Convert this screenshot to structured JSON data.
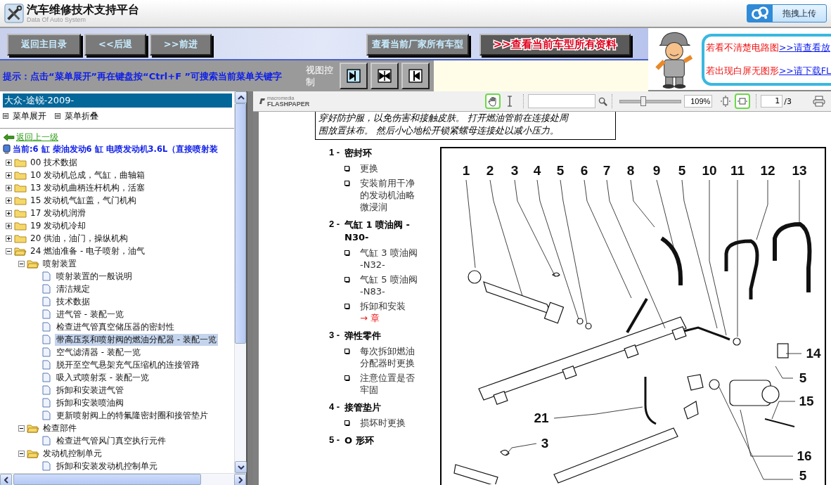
{
  "header": {
    "title": "汽车维修技术支持平台",
    "subtitle": "Data Of Auto System",
    "upload_button": "拖拽上传"
  },
  "nav_buttons": [
    "返回主目录",
    "<<后退",
    ">>前进"
  ],
  "model_buttons": [
    {
      "label": "查看当前厂家所有车型",
      "kind": "plain"
    },
    {
      "label": ">>查看当前车型所有资料",
      "kind": "highlight"
    }
  ],
  "hint": {
    "text": "提示：点击“菜单展开”再在键盘按“Ctrl+F ”可搜索当前菜单关键字",
    "view_label": "视图控制",
    "view_buttons": [
      {
        "kind": "right",
        "selected": true
      },
      {
        "kind": "split",
        "selected": false
      },
      {
        "kind": "left",
        "selected": false
      }
    ]
  },
  "notice": {
    "lines": [
      {
        "text": "若看不清楚电路图",
        "link": ">>请查看放"
      },
      {
        "text": "若出现白屏无图形",
        "link": ">>请下载FL"
      }
    ]
  },
  "sidebar": {
    "vehicle": "大众-途锐-2009-",
    "menu": [
      "菜单展开",
      "菜单折叠"
    ],
    "back_link": "返回上一级",
    "current": "当前:6 缸  柴油发动6 缸  电喷发动机3.6L（直接喷射装",
    "tree": [
      {
        "label": "00 技术数据",
        "kind": "folder",
        "expanded": false,
        "selected": false
      },
      {
        "label": "10 发动机总成，气缸，曲轴箱",
        "kind": "folder",
        "expanded": false,
        "selected": false
      },
      {
        "label": "13 发动机曲柄连杆机构，活塞",
        "kind": "folder",
        "expanded": false,
        "selected": false
      },
      {
        "label": "15 发动机气缸盖，气门机构",
        "kind": "folder",
        "expanded": false,
        "selected": false
      },
      {
        "label": "17 发动机润滑",
        "kind": "folder",
        "expanded": false,
        "selected": false
      },
      {
        "label": "19 发动机冷却",
        "kind": "folder",
        "expanded": false,
        "selected": false
      },
      {
        "label": "20 供油，油门，操纵机构",
        "kind": "folder",
        "expanded": false,
        "selected": false
      },
      {
        "label": "24 燃油准备 - 电子喷射，油气",
        "kind": "folder",
        "expanded": true,
        "selected": false,
        "children": [
          {
            "label": "喷射装置",
            "kind": "folder",
            "expanded": true,
            "selected": false,
            "children": [
              {
                "label": "喷射装置的一般说明",
                "kind": "doc",
                "selected": false
              },
              {
                "label": "清洁规定",
                "kind": "doc",
                "selected": false
              },
              {
                "label": "技术数据",
                "kind": "doc",
                "selected": false
              },
              {
                "label": "进气管 - 装配一览",
                "kind": "doc",
                "selected": false
              },
              {
                "label": "检查进气管真空储压器的密封性",
                "kind": "doc",
                "selected": false
              },
              {
                "label": "带高压泵和喷射阀的燃油分配器 - 装配一览",
                "kind": "doc",
                "selected": true
              },
              {
                "label": "空气滤清器 - 装配一览",
                "kind": "doc",
                "selected": false
              },
              {
                "label": "脱开至空气悬架充气压缩机的连接管路",
                "kind": "doc",
                "selected": false
              },
              {
                "label": "吸入式喷射泵 - 装配一览",
                "kind": "doc",
                "selected": false
              },
              {
                "label": "拆卸和安装进气管",
                "kind": "doc",
                "selected": false
              },
              {
                "label": "拆卸和安装喷油阀",
                "kind": "doc",
                "selected": false
              },
              {
                "label": "更新喷射阀上的特氟隆密封圈和接管垫片",
                "kind": "doc",
                "selected": false
              }
            ]
          },
          {
            "label": "检查部件",
            "kind": "folder",
            "expanded": true,
            "selected": false,
            "children": [
              {
                "label": "检查进气管风门真空执行元件",
                "kind": "doc",
                "selected": false
              }
            ]
          },
          {
            "label": "发动机控制单元",
            "kind": "folder",
            "expanded": true,
            "selected": false,
            "children": [
              {
                "label": "拆卸和安装发动机控制单元",
                "kind": "doc",
                "selected": false
              }
            ]
          }
        ]
      }
    ]
  },
  "viewer": {
    "brand_top": "macromedia",
    "brand": "FLASHPAPER",
    "tools": [
      {
        "kind": "hand",
        "selected": true
      },
      {
        "kind": "text",
        "selected": false
      }
    ],
    "zoom": {
      "level": 0.38,
      "value": "109%"
    },
    "fit_buttons": [
      {
        "kind": "height",
        "selected": false
      },
      {
        "kind": "width",
        "selected": true
      }
    ],
    "page": "1",
    "page_total": "/3"
  },
  "document": {
    "note_lines": [
      "穿好防护服，以免伤害和接触皮肤。 打开燃油管前在连接处周",
      "围放置抹布。 然后小心地松开锁紧螺母连接处以减小压力。"
    ],
    "parts": [
      {
        "number": "1 -",
        "name": "密封环",
        "notes": [
          {
            "text": "更换"
          },
          {
            "text": "安装前用干净的发动机油略微浸润"
          }
        ]
      },
      {
        "number": "2 -",
        "name": "气缸  1 喷油阀  -N30-",
        "notes": [
          {
            "text": "气缸  3 喷油阀  -N32-"
          },
          {
            "text": "气缸  5 喷油阀  -N83-"
          },
          {
            "text": "拆卸和安装",
            "link": "→ 章"
          }
        ]
      },
      {
        "number": "3 -",
        "name": "弹性零件",
        "notes": [
          {
            "text": "每次拆卸燃油分配器时更换"
          },
          {
            "text": "注意位置是否牢固"
          }
        ]
      },
      {
        "number": "4 -",
        "name": "接管垫片",
        "notes": [
          {
            "text": "损坏时更换"
          }
        ]
      },
      {
        "number": "5 -",
        "name": "O 形环"
      }
    ],
    "diagram": {
      "top_callouts": [
        "1",
        "2",
        "3",
        "4",
        "5",
        "6",
        "7",
        "8",
        "9",
        "5",
        "10",
        "11",
        "12",
        "13"
      ],
      "side_callouts": [
        "14",
        "5",
        "15",
        "16",
        "5",
        "21",
        "3"
      ]
    }
  }
}
